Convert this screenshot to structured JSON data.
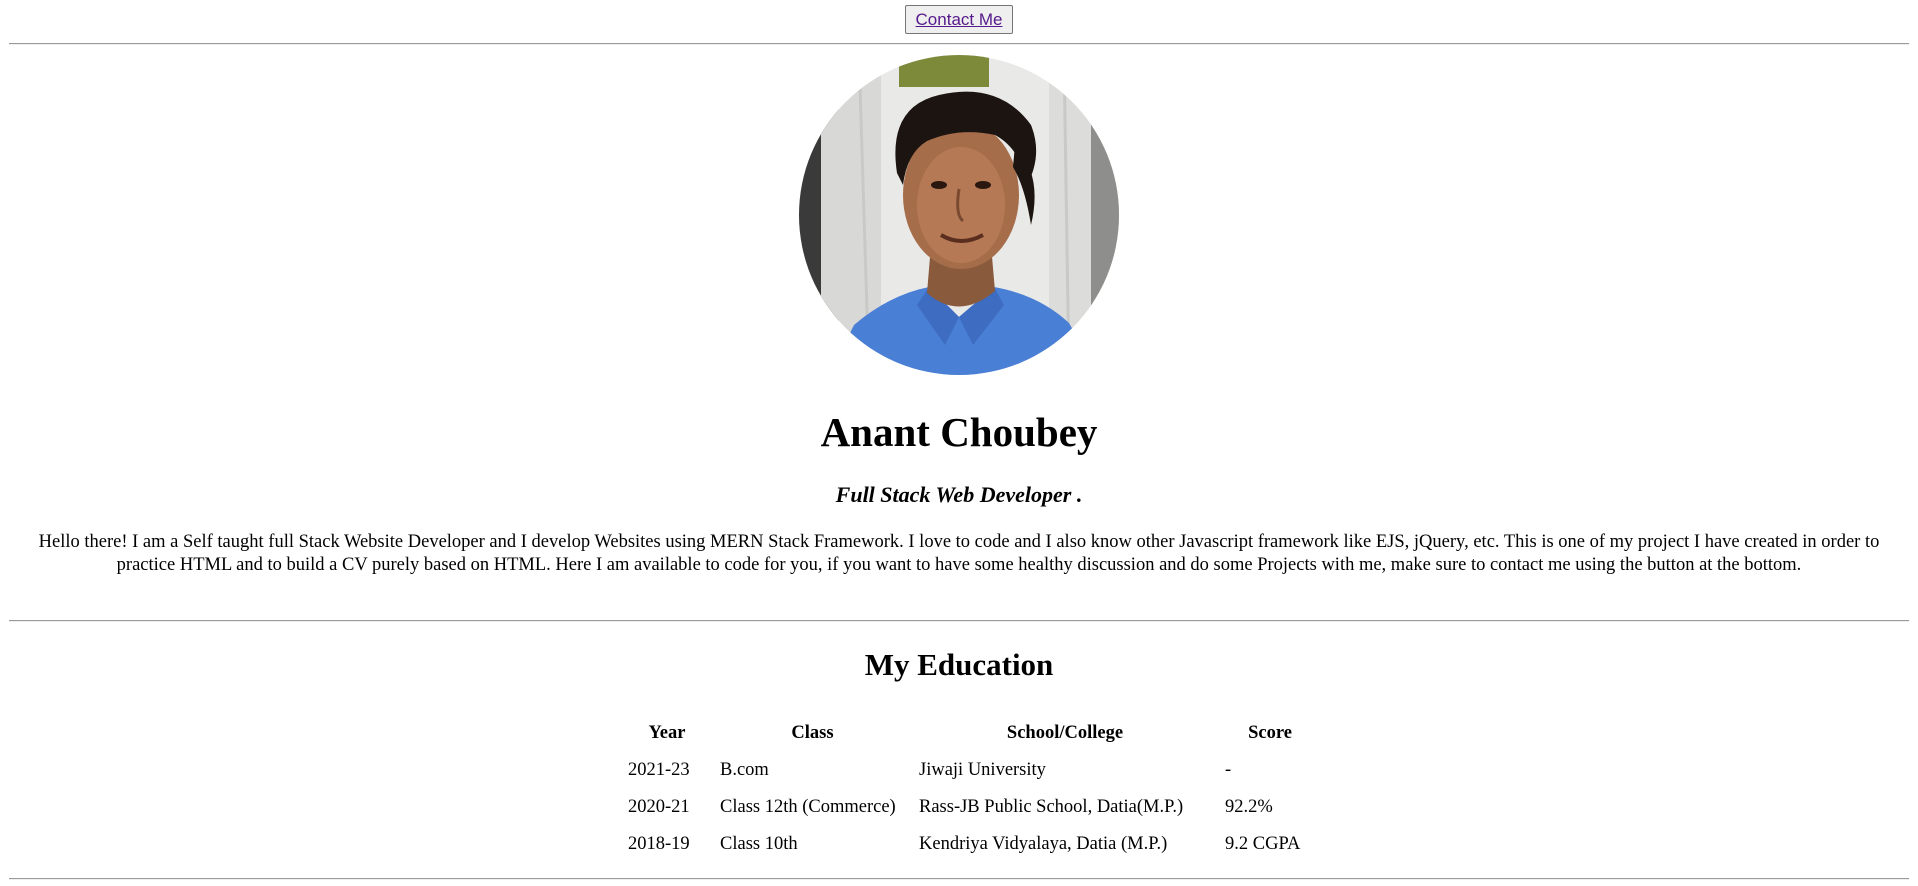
{
  "header": {
    "contact_label": "Contact Me"
  },
  "profile": {
    "photo_icon": "profile-photo",
    "name": "Anant Choubey",
    "subtitle": "Full Stack Web Developer .",
    "bio": "Hello there! I am a Self taught full Stack Website Developer and I develop Websites using MERN Stack Framework. I love to code and I also know other Javascript framework like EJS, jQuery, etc. This is one of my project I have created in order to practice HTML and to build a CV purely based on HTML. Here I am available to code for you, if you want to have some healthy discussion and do some Projects with me, make sure to contact me using the button at the bottom."
  },
  "education": {
    "title": "My Education",
    "columns": [
      "Year",
      "Class",
      "School/College",
      "Score"
    ],
    "rows": [
      [
        "2021-23",
        "B.com",
        "Jiwaji University",
        "-"
      ],
      [
        "2020-21",
        "Class 12th (Commerce)",
        "Rass-JB Public School, Datia(M.P.)",
        "92.2%"
      ],
      [
        "2018-19",
        "Class 10th",
        "Kendriya Vidyalaya, Datia (M.P.)",
        "9.2 CGPA"
      ]
    ]
  },
  "colors": {
    "link": "#551a8b",
    "rule": "#9a9a9a",
    "shirt": "#4a7fd6"
  }
}
